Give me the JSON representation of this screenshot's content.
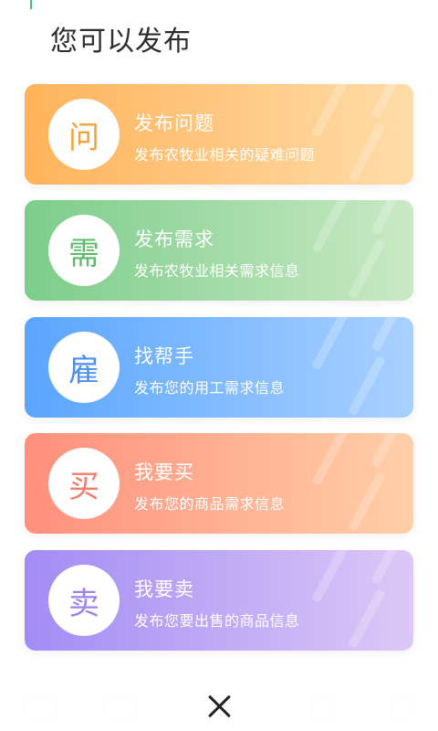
{
  "title": "您可以发布",
  "options": [
    {
      "icon_char": "问",
      "label": "发布问题",
      "desc": "发布农牧业相关的疑难问题",
      "color_start": "#ffb35a",
      "color_end": "#ffdca8",
      "icon_color": "#f4a23a"
    },
    {
      "icon_char": "需",
      "label": "发布需求",
      "desc": "发布农牧业相关需求信息",
      "color_start": "#7ccd8a",
      "color_end": "#c9e9c4",
      "icon_color": "#5cb86a"
    },
    {
      "icon_char": "雇",
      "label": "找帮手",
      "desc": "发布您的用工需求信息",
      "color_start": "#5aa5ff",
      "color_end": "#a9d1ff",
      "icon_color": "#4b8ef2"
    },
    {
      "icon_char": "买",
      "label": "我要买",
      "desc": "发布您的商品需求信息",
      "color_start": "#ff8f7c",
      "color_end": "#ffcfa8",
      "icon_color": "#f07c6a"
    },
    {
      "icon_char": "卖",
      "label": "我要卖",
      "desc": "发布您要出售的商品信息",
      "color_start": "#a28cf4",
      "color_end": "#dcc8f6",
      "icon_color": "#9b82ec"
    }
  ],
  "close_icon": "close-icon"
}
